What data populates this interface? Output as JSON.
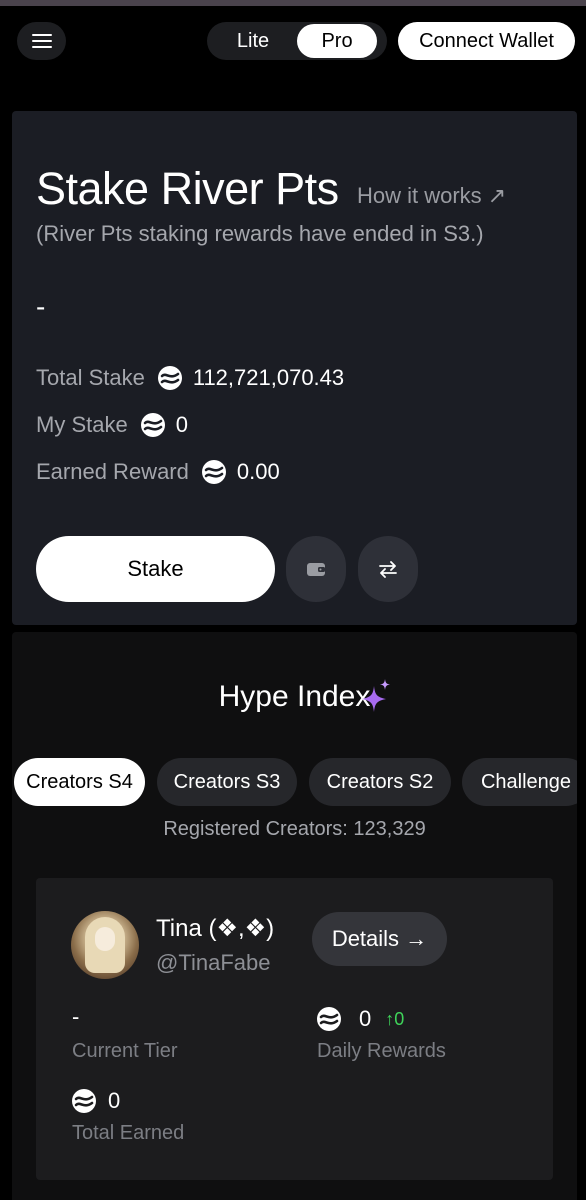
{
  "header": {
    "menu_icon": "hamburger-icon",
    "mode_options": [
      "Lite",
      "Pro"
    ],
    "mode_selected": "Pro",
    "connect_label": "Connect Wallet"
  },
  "stake": {
    "title": "Stake River Pts",
    "how_label": "How it works ↗",
    "subtitle": "(River Pts staking rewards have ended in S3.)",
    "dash": "-",
    "total_label": "Total Stake",
    "total_value": "112,721,070.43",
    "my_label": "My Stake",
    "my_value": "0",
    "earned_label": "Earned Reward",
    "earned_value": "0.00",
    "stake_button": "Stake",
    "wallet_icon": "wallet-icon",
    "swap_icon": "swap-icon"
  },
  "hype": {
    "title": "Hype Index",
    "tabs": [
      "Creators S4",
      "Creators S3",
      "Creators S2",
      "Challenge"
    ],
    "active_tab": "Creators S4",
    "registered": "Registered Creators: 123,329",
    "creator": {
      "name": "Tina (❖,❖)",
      "handle": "@TinaFabe",
      "details_label": "Details →",
      "tier_value": "-",
      "tier_label": "Current Tier",
      "daily_value": "0",
      "daily_change": "↑0",
      "daily_label": "Daily Rewards",
      "earned_value": "0",
      "earned_label": "Total Earned"
    }
  },
  "colors": {
    "background": "#000000",
    "card": "#1b1d24",
    "accent_green": "#3fd45a",
    "sparkle": "#a86bf0"
  }
}
